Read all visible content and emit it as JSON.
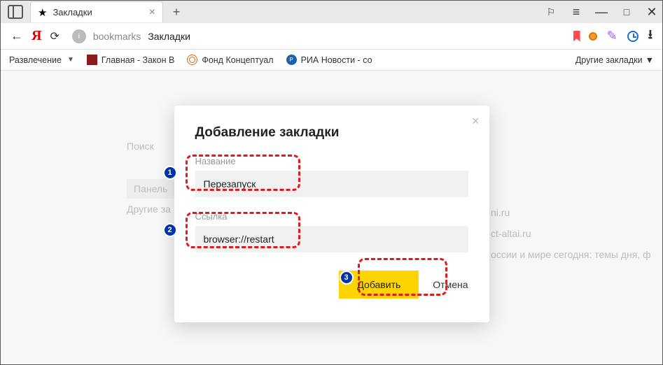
{
  "tab": {
    "title": "Закладки"
  },
  "address": {
    "segment1": "bookmarks",
    "segment2": "Закладки"
  },
  "bookmarks_bar": {
    "items": [
      {
        "label": "Развлечение",
        "has_dropdown": true
      },
      {
        "label": "Главная - Закон В"
      },
      {
        "label": "Фонд Концептуал"
      },
      {
        "label": "РИА Новости - со"
      }
    ],
    "other": "Другие закладки"
  },
  "backdrop": {
    "search": "Поиск",
    "panel": "Панель",
    "other": "Другие за",
    "frag1": "ni.ru",
    "frag2": "ct-altai.ru",
    "frag3": "оссии и мире сегодня: темы дня, ф"
  },
  "dialog": {
    "title": "Добавление закладки",
    "name_label": "Название",
    "name_value": "Перезапуск",
    "url_label": "Ссылка",
    "url_value": "browser://restart",
    "add": "Добавить",
    "cancel": "Отмена"
  },
  "annotations": {
    "b1": "1",
    "b2": "2",
    "b3": "3"
  }
}
